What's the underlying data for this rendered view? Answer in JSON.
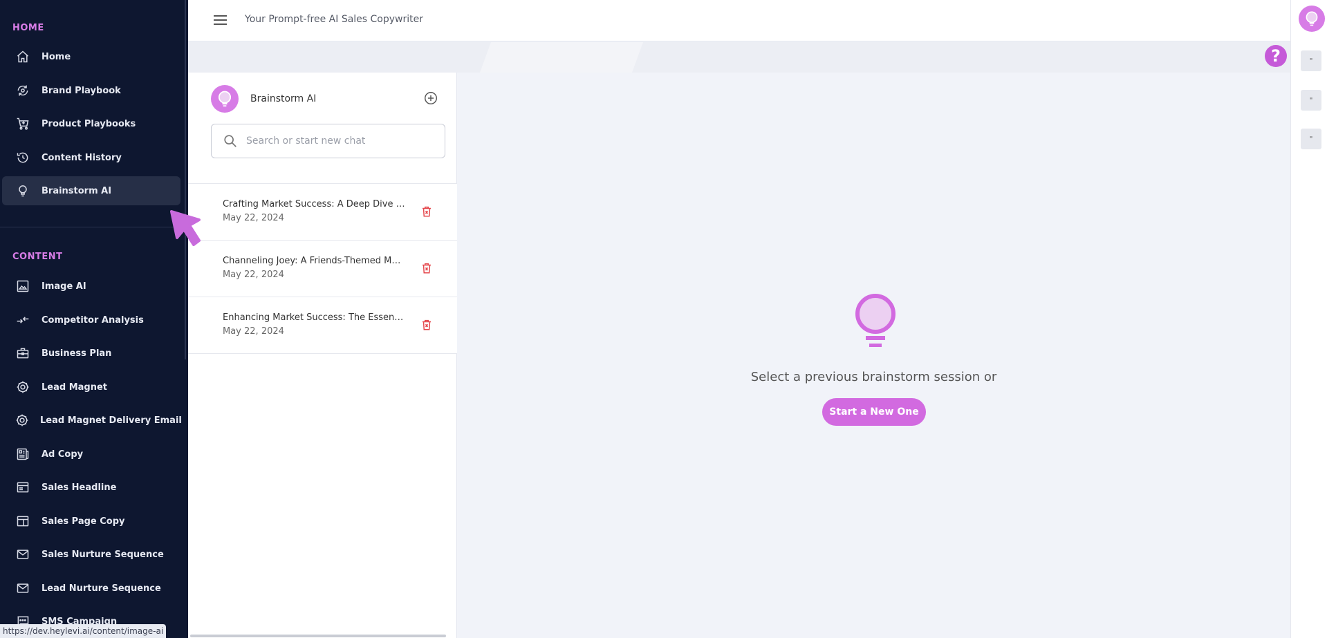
{
  "sidebar": {
    "sections": [
      {
        "title": "HOME",
        "items": [
          {
            "label": "Home",
            "icon": "home-icon"
          },
          {
            "label": "Brand Playbook",
            "icon": "brand-playbook-icon"
          },
          {
            "label": "Product Playbooks",
            "icon": "cart-icon"
          },
          {
            "label": "Content History",
            "icon": "history-icon"
          },
          {
            "label": "Brainstorm AI",
            "icon": "lightbulb-icon",
            "active": true
          }
        ]
      },
      {
        "title": "CONTENT",
        "items": [
          {
            "label": "Image AI",
            "icon": "image-icon"
          },
          {
            "label": "Competitor Analysis",
            "icon": "compare-arrows-icon"
          },
          {
            "label": "Business Plan",
            "icon": "briefcase-icon"
          },
          {
            "label": "Lead Magnet",
            "icon": "magnet-icon"
          },
          {
            "label": "Lead Magnet Delivery Email",
            "icon": "magnet-email-icon"
          },
          {
            "label": "Ad Copy",
            "icon": "newspaper-icon"
          },
          {
            "label": "Sales Headline",
            "icon": "headline-icon"
          },
          {
            "label": "Sales Page Copy",
            "icon": "page-copy-icon"
          },
          {
            "label": "Sales Nurture Sequence",
            "icon": "mail-icon"
          },
          {
            "label": "Lead Nurture Sequence",
            "icon": "mail-icon"
          },
          {
            "label": "SMS Campaign",
            "icon": "sms-icon"
          }
        ]
      }
    ]
  },
  "status_bar": {
    "url": "https://dev.heylevi.ai/content/image-ai"
  },
  "header": {
    "title": "Your Prompt-free AI Sales Copywriter"
  },
  "right_strip": {
    "buttons": [
      "\"",
      "\"",
      "\""
    ],
    "help_label": "?"
  },
  "chat_panel": {
    "title": "Brainstorm AI",
    "search_placeholder": "Search or start new chat",
    "chats": [
      {
        "title": "Crafting Market Success: A Deep Dive into Growth",
        "date": "May 22, 2024"
      },
      {
        "title": "Channeling Joey: A Friends-Themed Marketing Plan",
        "date": "May 22, 2024"
      },
      {
        "title": "Enhancing Market Success: The Essential Guide",
        "date": "May 22, 2024"
      }
    ]
  },
  "empty_state": {
    "message": "Select a previous brainstorm session or",
    "button_label": "Start a New One"
  },
  "colors": {
    "sidebar_bg": "#0e1730",
    "accent": "#d77ce6",
    "button": "#d26ae0",
    "delete": "#e5484d"
  }
}
